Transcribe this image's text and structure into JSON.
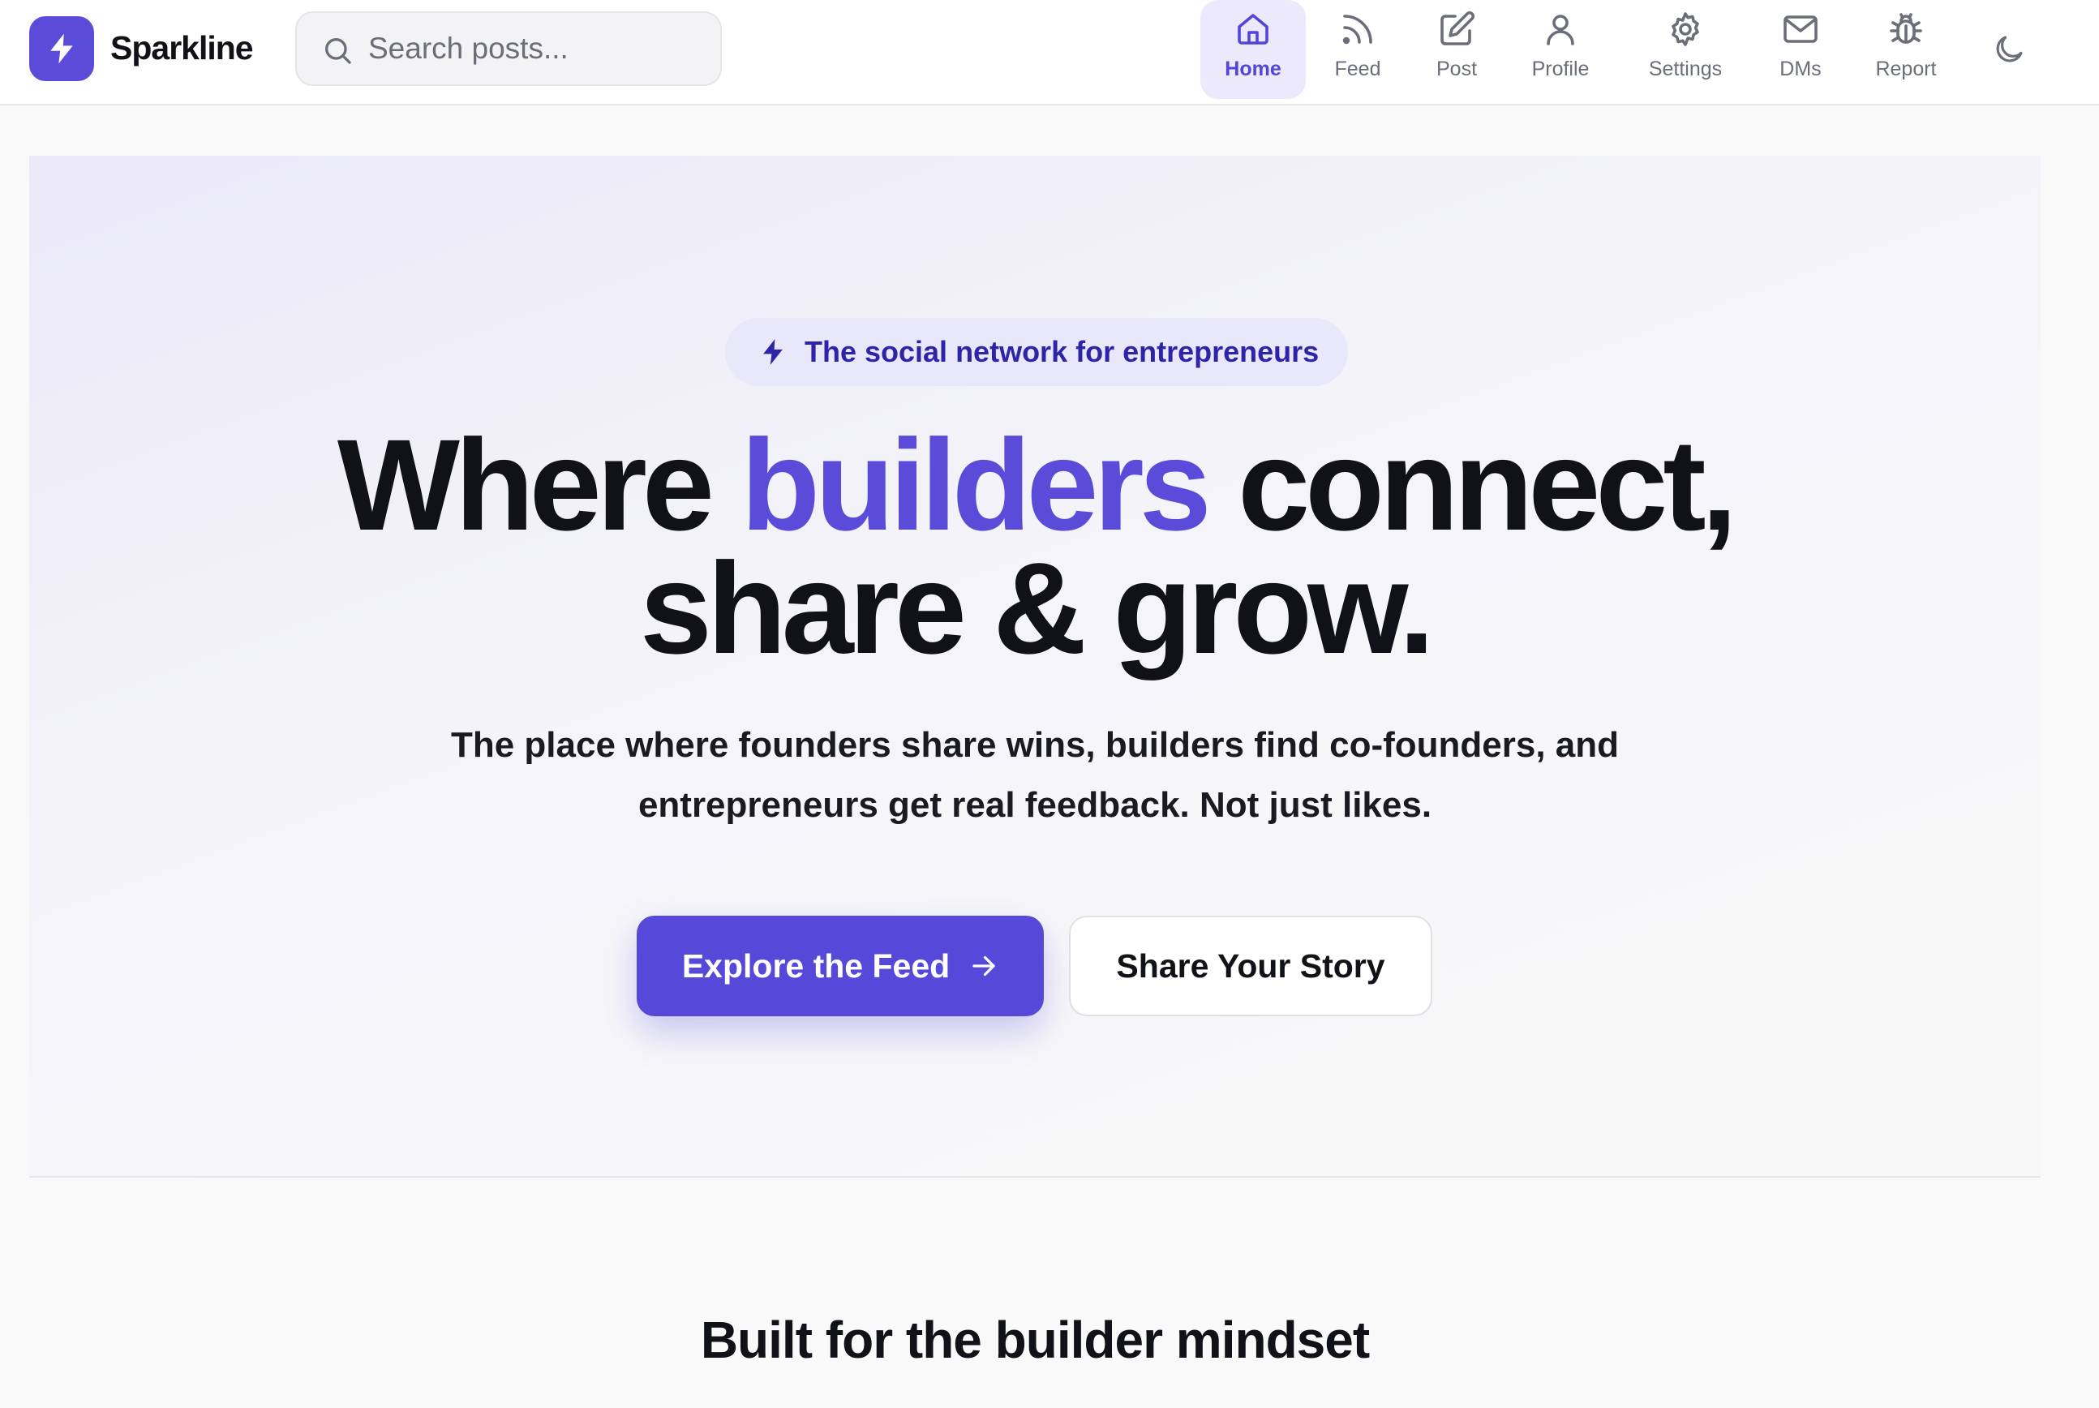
{
  "brand": {
    "name": "Sparkline",
    "logo_icon": "lightning-bolt-icon",
    "accent_color": "#5b4bd9"
  },
  "search": {
    "placeholder": "Search posts...",
    "value": ""
  },
  "nav": {
    "items": [
      {
        "label": "Home",
        "icon": "home-icon",
        "active": true
      },
      {
        "label": "Feed",
        "icon": "rss-icon",
        "active": false
      },
      {
        "label": "Post",
        "icon": "edit-icon",
        "active": false
      },
      {
        "label": "Profile",
        "icon": "user-icon",
        "active": false
      },
      {
        "label": "Settings",
        "icon": "gear-icon",
        "active": false
      },
      {
        "label": "DMs",
        "icon": "mail-icon",
        "active": false
      },
      {
        "label": "Report",
        "icon": "bug-icon",
        "active": false
      }
    ],
    "theme_toggle_icon": "moon-icon"
  },
  "hero": {
    "badge": "The social network for entrepreneurs",
    "headline": {
      "part1": "Where ",
      "accent": "builders",
      "part2": " connect,",
      "line2": "share & grow."
    },
    "subheadline": "The place where founders share wins, builders find co-founders, and entrepreneurs get real feedback. Not just likes.",
    "primary_cta": "Explore the Feed",
    "secondary_cta": "Share Your Story"
  },
  "features": {
    "title": "Built for the builder mindset"
  }
}
